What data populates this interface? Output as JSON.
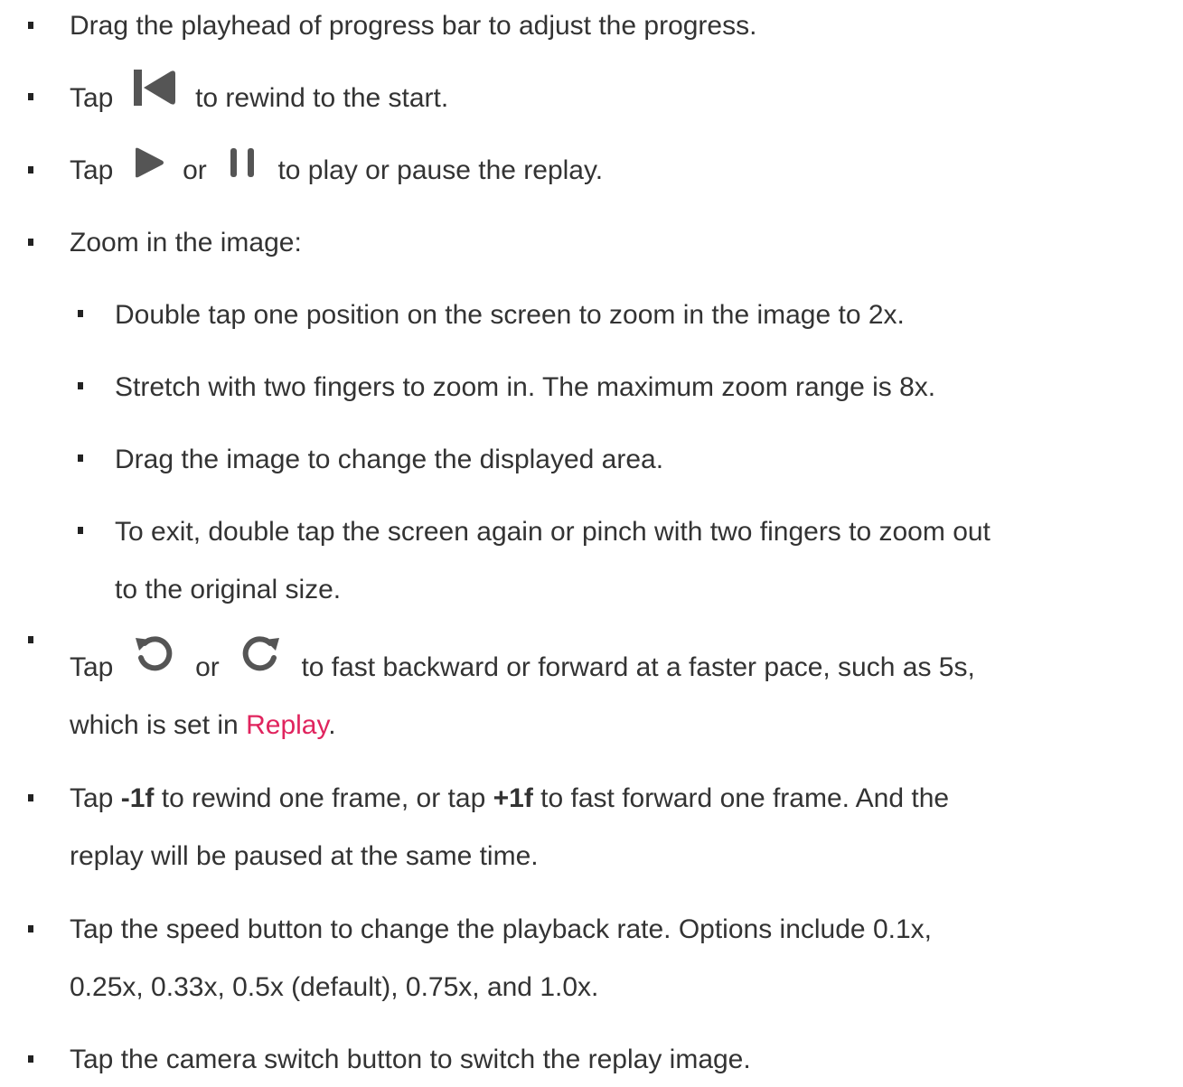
{
  "link_color": "#e0245e",
  "text_color": "#333333",
  "items": {
    "i1": {
      "text": "Drag the playhead of progress bar to adjust the progress."
    },
    "i2": {
      "a": "Tap",
      "icon": "skip-to-start-icon",
      "b": "to rewind to the start."
    },
    "i3": {
      "a": "Tap",
      "icon1": "play-icon",
      "or": "or",
      "icon2": "pause-icon",
      "b": "to play or pause the replay."
    },
    "i4": {
      "text": "Zoom in the image:",
      "sub": [
        "Double tap one position on the screen to zoom in the image to 2x.",
        "Stretch with two fingers to zoom in. The maximum zoom range is 8x.",
        "Drag the image to change the displayed area."
      ],
      "sub4": {
        "line1": "To exit, double tap the screen again or pinch with two fingers to zoom out",
        "line2": "to the original size."
      }
    },
    "i5": {
      "a": "Tap",
      "icon1": "rewind-circular-arrow-icon",
      "or": "or",
      "icon2": "forward-circular-arrow-icon",
      "b": "to fast backward or forward at a faster pace, such as 5s,",
      "c": "which is set in",
      "link": "Replay",
      "d": "."
    },
    "i6": {
      "a": "Tap",
      "bold1": "-1f",
      "b": "to rewind one frame, or tap",
      "bold2": "+1f",
      "c": "to fast forward one frame. And the",
      "line2": "replay will be paused at the same time."
    },
    "i7": {
      "line1": "Tap the speed button to change the playback rate. Options include 0.1x,",
      "line2": "0.25x, 0.33x, 0.5x (default), 0.75x, and 1.0x."
    },
    "i8": {
      "text": "Tap the camera switch button to switch the replay image."
    }
  }
}
